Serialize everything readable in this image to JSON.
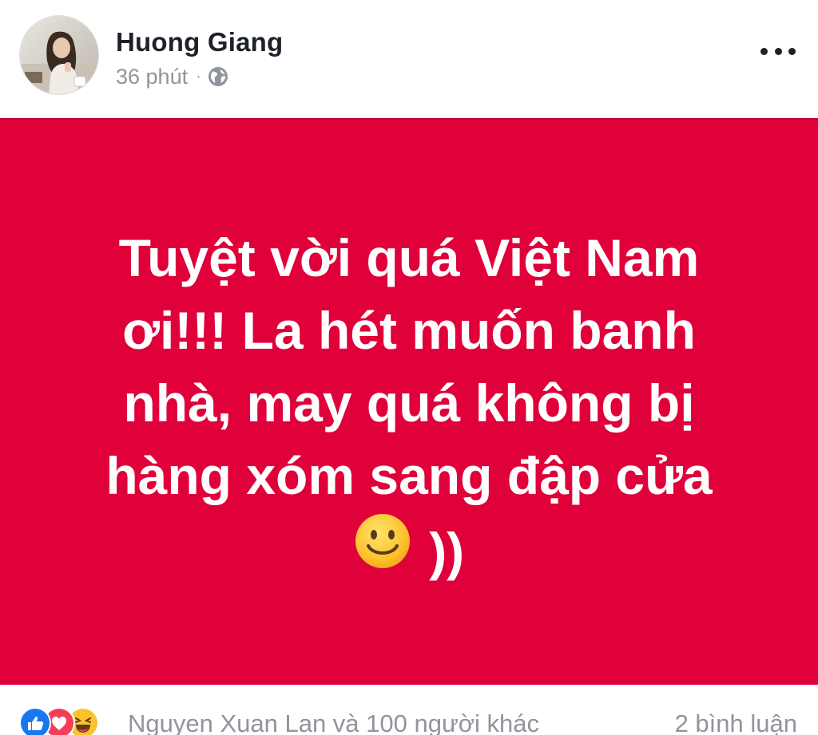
{
  "post": {
    "author": {
      "name": "Huong Giang"
    },
    "timestamp": "36 phút",
    "separator": "·",
    "privacy_icon": "globe-icon",
    "more_icon": "more-options-icon",
    "content": {
      "background_color": "#e0003a",
      "text_color": "#ffffff",
      "lines": [
        "Tuyệt vời quá Việt Nam",
        "ơi!!! La hét muốn banh",
        "nhà, may quá không bị",
        "hàng xóm sang đập cửa"
      ],
      "emoji": "slightly-smiling-face-icon",
      "trailing_text": "))"
    },
    "footer": {
      "reactions": [
        "like-icon",
        "love-icon",
        "haha-icon"
      ],
      "reactors_text": "Nguyen Xuan Lan và 100 người khác",
      "comments_text": "2 bình luận"
    }
  }
}
